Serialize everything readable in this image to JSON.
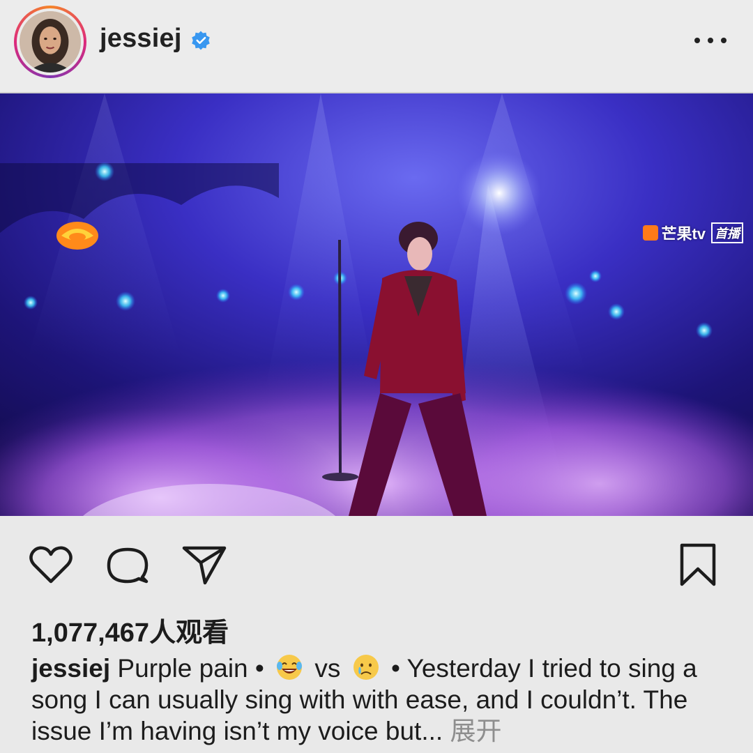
{
  "post": {
    "username": "jessiej",
    "verified": true,
    "avatar_icon": "user-avatar",
    "more_icon": "more-options-icon"
  },
  "video": {
    "channel_watermark": "芒果tv",
    "channel_badge": "首播",
    "mute_icon": "speaker-muted-icon"
  },
  "actions": {
    "like_icon": "heart-icon",
    "comment_icon": "comment-bubble-icon",
    "share_icon": "paper-plane-icon",
    "save_icon": "bookmark-icon"
  },
  "stats": {
    "views": "1,077,467",
    "views_suffix": "人观看"
  },
  "caption": {
    "username": "jessiej",
    "part1": " Purple pain • ",
    "emoji1": "laughing-crying-emoji",
    "vs": " vs ",
    "emoji2": "crying-emoji",
    "part2": " • Yesterday I tried to sing a song I can usually sing with with ease, and I couldn’t. The issue I’m having isn’t my voice but...",
    "more_label": " 展开"
  },
  "colors": {
    "background": "#e9e9e9",
    "text": "#1c1c1c",
    "verified_blue": "#3897f0",
    "muted_text": "#8e8e8e"
  }
}
